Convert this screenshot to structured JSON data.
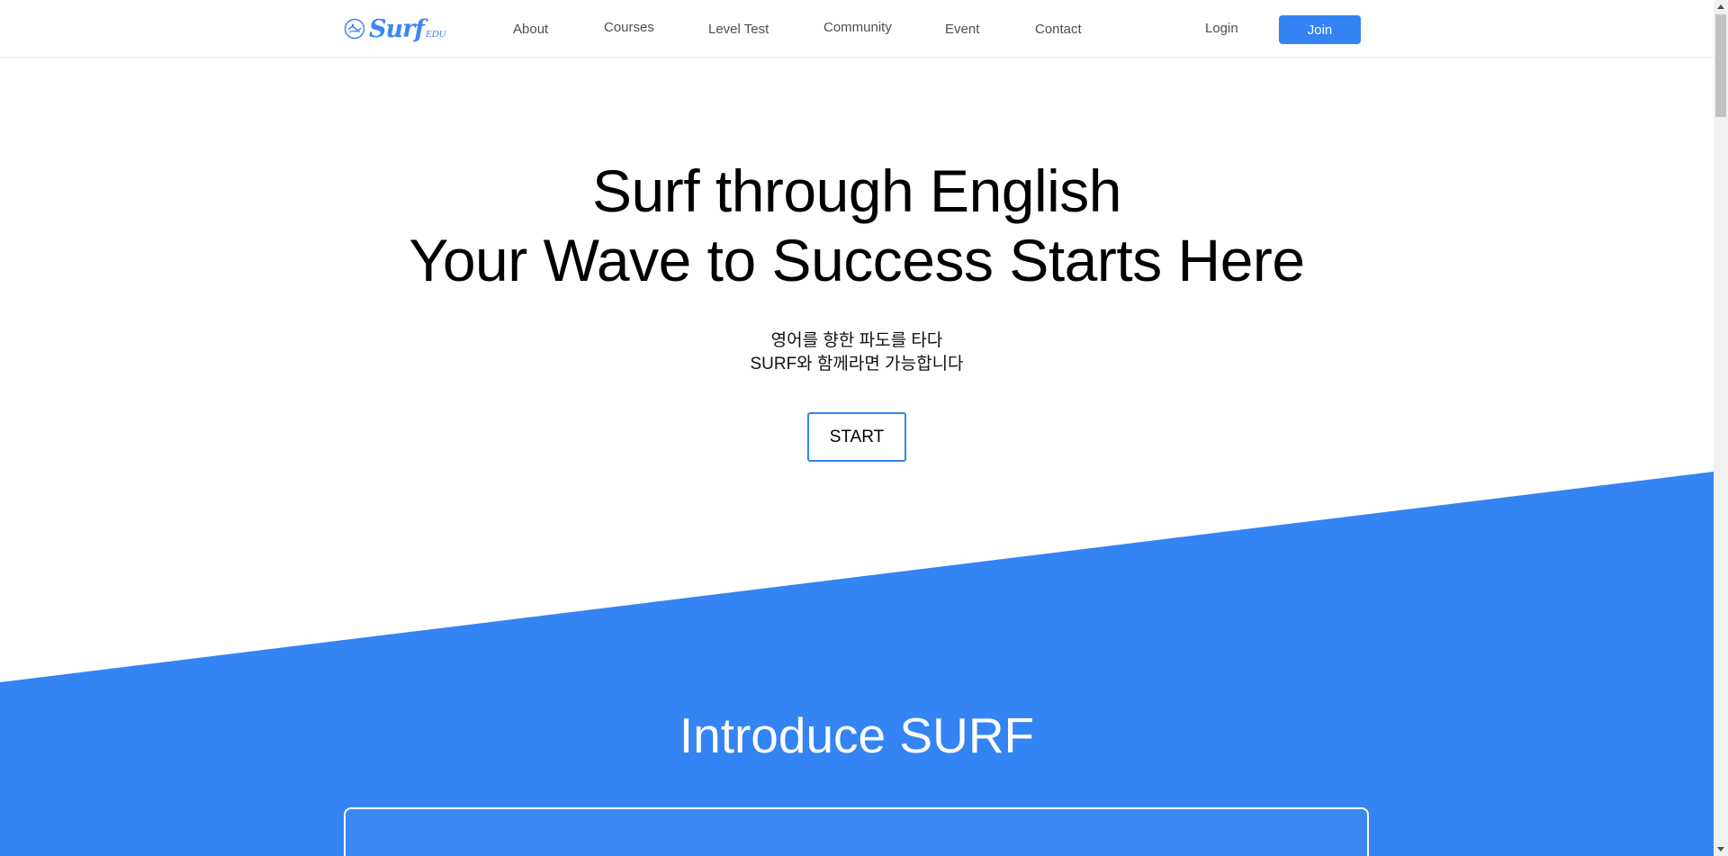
{
  "brand": {
    "logo_text": "Surf",
    "logo_sub": "EDU",
    "accent_color": "#3484f3"
  },
  "nav": {
    "items": [
      {
        "label": "About"
      },
      {
        "label": "Courses"
      },
      {
        "label": "Level Test"
      },
      {
        "label": "Community"
      },
      {
        "label": "Event"
      },
      {
        "label": "Contact"
      }
    ],
    "login_label": "Login",
    "join_label": "Join"
  },
  "hero": {
    "title_line1": "Surf through English",
    "title_line2": "Your Wave to Success Starts Here",
    "subtitle_line1": "영어를 향한 파도를 타다",
    "subtitle_line2": "SURF와 함께라면 가능합니다",
    "start_label": "START"
  },
  "intro": {
    "title": "Introduce SURF"
  },
  "icons": [
    "surf-logo-icon",
    "scroll-up-arrow-icon",
    "scroll-down-arrow-icon"
  ]
}
